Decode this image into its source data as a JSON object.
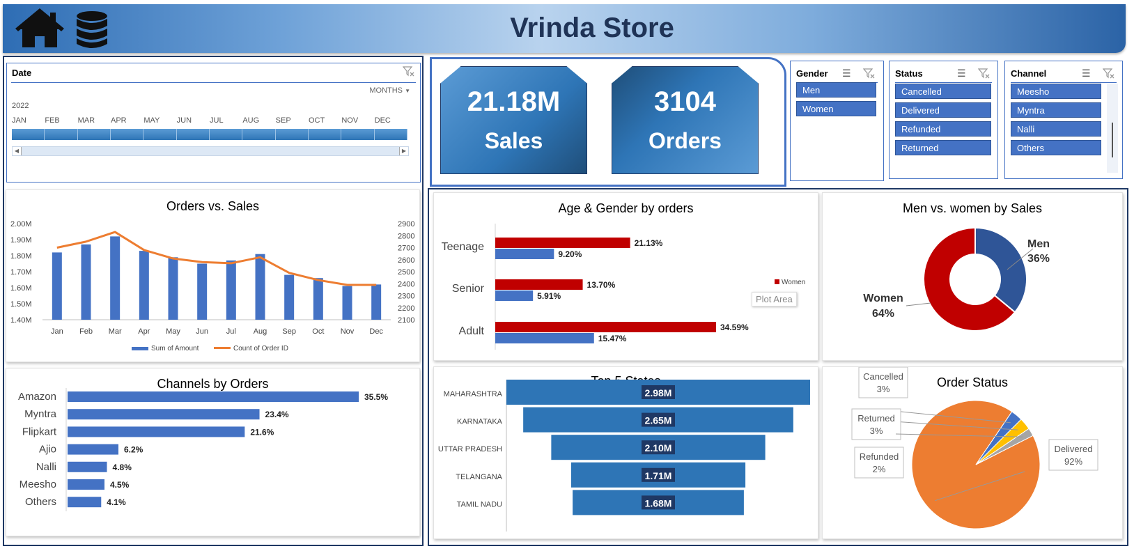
{
  "header": {
    "title": "Vrinda Store",
    "home_icon": "home-icon",
    "data_icon": "database-icon"
  },
  "timeline": {
    "label": "Date",
    "period": "MONTHS",
    "year": "2022",
    "months": [
      "JAN",
      "FEB",
      "MAR",
      "APR",
      "MAY",
      "JUN",
      "JUL",
      "AUG",
      "SEP",
      "OCT",
      "NOV",
      "DEC"
    ]
  },
  "kpis": {
    "sales_value": "21.18M",
    "sales_label": "Sales",
    "orders_value": "3104",
    "orders_label": "Orders"
  },
  "slicers": {
    "gender": {
      "label": "Gender",
      "items": [
        "Men",
        "Women"
      ]
    },
    "status": {
      "label": "Status",
      "items": [
        "Cancelled",
        "Delivered",
        "Refunded",
        "Returned"
      ]
    },
    "channel": {
      "label": "Channel",
      "items": [
        "Meesho",
        "Myntra",
        "Nalli",
        "Others"
      ]
    }
  },
  "chart_data": [
    {
      "type": "bar",
      "title": "Orders vs. Sales",
      "categories": [
        "Jan",
        "Feb",
        "Mar",
        "Apr",
        "May",
        "Jun",
        "Jul",
        "Aug",
        "Sep",
        "Oct",
        "Nov",
        "Dec"
      ],
      "series": [
        {
          "name": "Sum of Amount",
          "type": "bar",
          "axis": "left",
          "values": [
            1.82,
            1.87,
            1.92,
            1.83,
            1.79,
            1.75,
            1.77,
            1.81,
            1.68,
            1.66,
            1.61,
            1.62
          ]
        },
        {
          "name": "Count of Order ID",
          "type": "line",
          "axis": "right",
          "values": [
            2700,
            2750,
            2830,
            2680,
            2610,
            2580,
            2570,
            2620,
            2490,
            2430,
            2390,
            2390
          ]
        }
      ],
      "ylim_left": [
        1.4,
        2.0
      ],
      "yticks_left": [
        "1.40M",
        "1.50M",
        "1.60M",
        "1.70M",
        "1.80M",
        "1.90M",
        "2.00M"
      ],
      "ylim_right": [
        2100,
        2900
      ],
      "yticks_right": [
        "2100",
        "2200",
        "2300",
        "2400",
        "2500",
        "2600",
        "2700",
        "2800",
        "2900"
      ],
      "legend": "bottom",
      "colors": {
        "bar": "#4472c4",
        "line": "#ed7d31"
      }
    },
    {
      "type": "bar",
      "orientation": "horizontal",
      "title": "Age & Gender by orders",
      "categories": [
        "Teenage",
        "Senior",
        "Adult"
      ],
      "series": [
        {
          "name": "Women",
          "values": [
            21.13,
            13.7,
            34.59
          ],
          "labels": [
            "21.13%",
            "13.70%",
            "34.59%"
          ],
          "color": "#c00000"
        },
        {
          "name": "Men",
          "values": [
            9.2,
            5.91,
            15.47
          ],
          "labels": [
            "9.20%",
            "5.91%",
            "15.47%"
          ],
          "color": "#4472c4"
        }
      ],
      "legend": "right",
      "tooltip": "Plot Area"
    },
    {
      "type": "pie",
      "subtype": "donut",
      "title": "Men vs. women by Sales",
      "slices": [
        {
          "name": "Men",
          "value": 36,
          "label": "36%",
          "color": "#2f5597"
        },
        {
          "name": "Women",
          "value": 64,
          "label": "64%",
          "color": "#c00000"
        }
      ]
    },
    {
      "type": "bar",
      "orientation": "horizontal",
      "title": "Channels by Orders",
      "categories": [
        "Amazon",
        "Myntra",
        "Flipkart",
        "Ajio",
        "Nalli",
        "Meesho",
        "Others"
      ],
      "values": [
        35.5,
        23.4,
        21.6,
        6.2,
        4.8,
        4.5,
        4.1
      ],
      "labels": [
        "35.5%",
        "23.4%",
        "21.6%",
        "6.2%",
        "4.8%",
        "4.5%",
        "4.1%"
      ],
      "color": "#4472c4"
    },
    {
      "type": "bar",
      "subtype": "funnel",
      "title": "Top 5 States",
      "categories": [
        "MAHARASHTRA",
        "KARNATAKA",
        "UTTAR PRADESH",
        "TELANGANA",
        "TAMIL NADU"
      ],
      "values": [
        2.98,
        2.65,
        2.1,
        1.71,
        1.68
      ],
      "labels": [
        "2.98M",
        "2.65M",
        "2.10M",
        "1.71M",
        "1.68M"
      ],
      "color": "#2e75b6"
    },
    {
      "type": "pie",
      "title": "Order Status",
      "slices": [
        {
          "name": "Delivered",
          "value": 92,
          "label": "92%",
          "color": "#ed7d31"
        },
        {
          "name": "Cancelled",
          "value": 3,
          "label": "3%",
          "color": "#4472c4"
        },
        {
          "name": "Returned",
          "value": 3,
          "label": "3%",
          "color": "#ffc000"
        },
        {
          "name": "Refunded",
          "value": 2,
          "label": "2%",
          "color": "#a5a5a5"
        }
      ]
    }
  ]
}
